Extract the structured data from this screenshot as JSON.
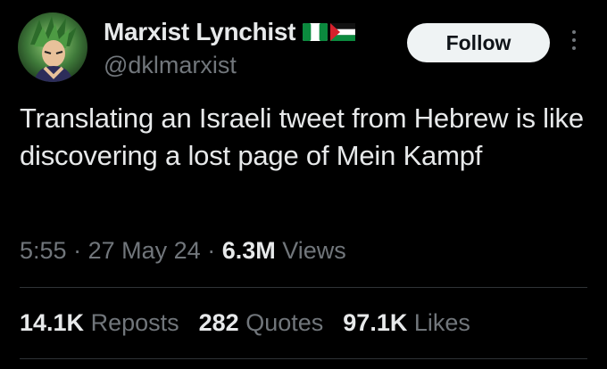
{
  "author": {
    "display_name": "Marxist Lynchist",
    "handle": "@dklmarxist",
    "flags": [
      "nigeria-flag-icon",
      "palestine-flag-icon"
    ]
  },
  "follow_label": "Follow",
  "tweet": {
    "text": "Translating an Israeli tweet from Hebrew is like discovering a lost page of Mein Kampf"
  },
  "meta": {
    "time": "5:55",
    "date": "27 May 24",
    "views_count": "6.3M",
    "views_label": "Views",
    "separator": "·"
  },
  "stats": {
    "reposts_count": "14.1K",
    "reposts_label": "Reposts",
    "quotes_count": "282",
    "quotes_label": "Quotes",
    "likes_count": "97.1K",
    "likes_label": "Likes"
  },
  "colors": {
    "background": "#000000",
    "text_primary": "#e7e9ea",
    "text_secondary": "#71767b",
    "follow_bg": "#eff3f4",
    "divider": "#2f3336"
  }
}
